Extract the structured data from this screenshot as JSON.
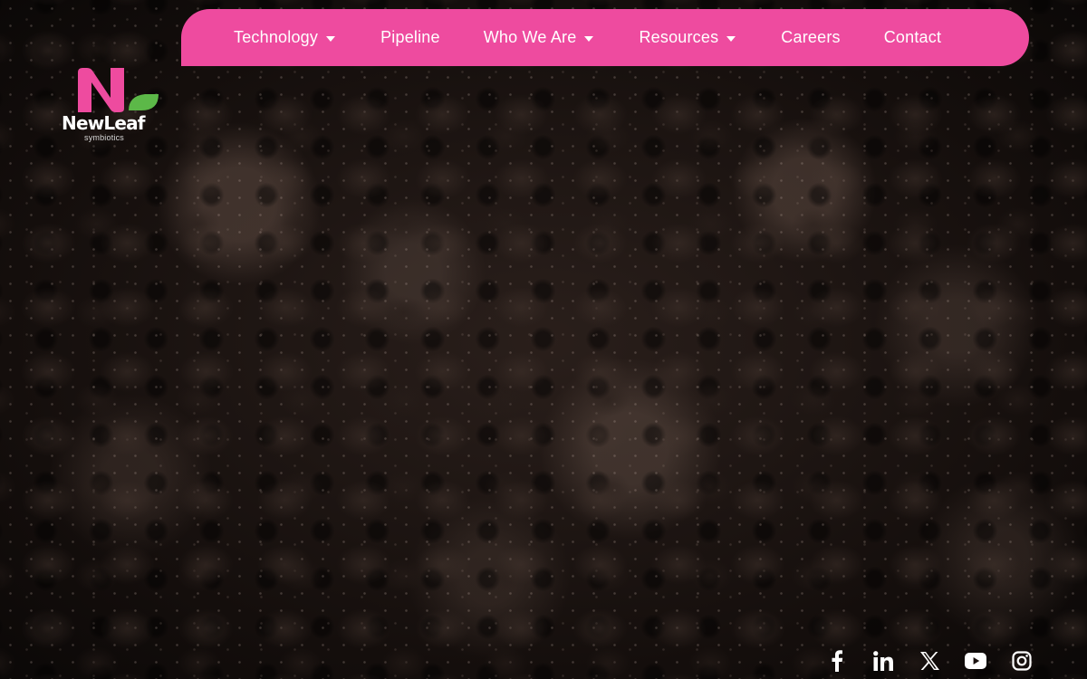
{
  "nav": {
    "items": [
      {
        "label": "Technology",
        "has_dropdown": true
      },
      {
        "label": "Pipeline",
        "has_dropdown": false
      },
      {
        "label": "Who We Are",
        "has_dropdown": true
      },
      {
        "label": "Resources",
        "has_dropdown": true
      },
      {
        "label": "Careers",
        "has_dropdown": false
      },
      {
        "label": "Contact",
        "has_dropdown": false
      }
    ],
    "background_color": "#ee4b9f"
  },
  "logo": {
    "name": "NewLeaf",
    "tagline": "symbiotics",
    "mark_color": "#ee4b9f",
    "leaf_color": "#5cb848"
  },
  "social": {
    "icons": [
      "facebook-icon",
      "linkedin-icon",
      "x-icon",
      "youtube-icon",
      "instagram-icon"
    ]
  },
  "hero": {
    "background": "dark soil texture"
  }
}
